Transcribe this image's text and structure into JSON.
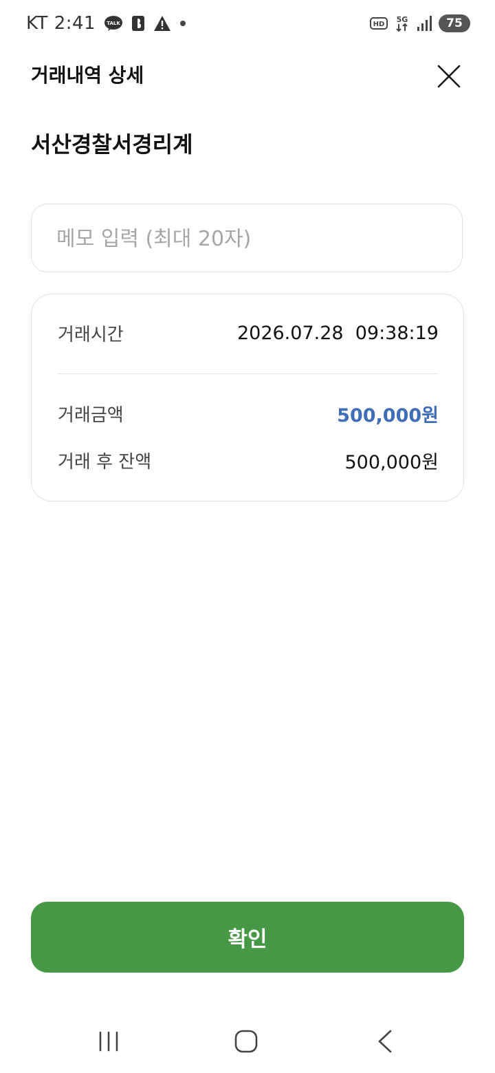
{
  "status_bar": {
    "carrier": "KT",
    "time": "2:41",
    "notifications": [
      "kakaotalk-icon",
      "b-app-icon",
      "warning-icon",
      "dot-icon"
    ],
    "indicators": [
      "hd-icon",
      "5g-icon",
      "signal-icon"
    ],
    "battery": "75",
    "talk_label": "TALK"
  },
  "header": {
    "title": "거래내역 상세",
    "close_icon": "close-icon"
  },
  "merchant_name": "서산경찰서경리계",
  "memo": {
    "placeholder": "메모 입력 (최대 20자)",
    "value": ""
  },
  "details": {
    "time_label": "거래시간",
    "time_value": "2026.07.28  09:38:19",
    "amount_label": "거래금액",
    "amount_value": "500,000원",
    "balance_label": "거래 후 잔액",
    "balance_value": "500,000원"
  },
  "confirm_button": "확인",
  "colors": {
    "accent_blue": "#3f6db6",
    "confirm_green": "#479845",
    "border": "#e2e2e2"
  },
  "nav_bar": [
    "recent-apps-icon",
    "home-icon",
    "back-icon"
  ]
}
